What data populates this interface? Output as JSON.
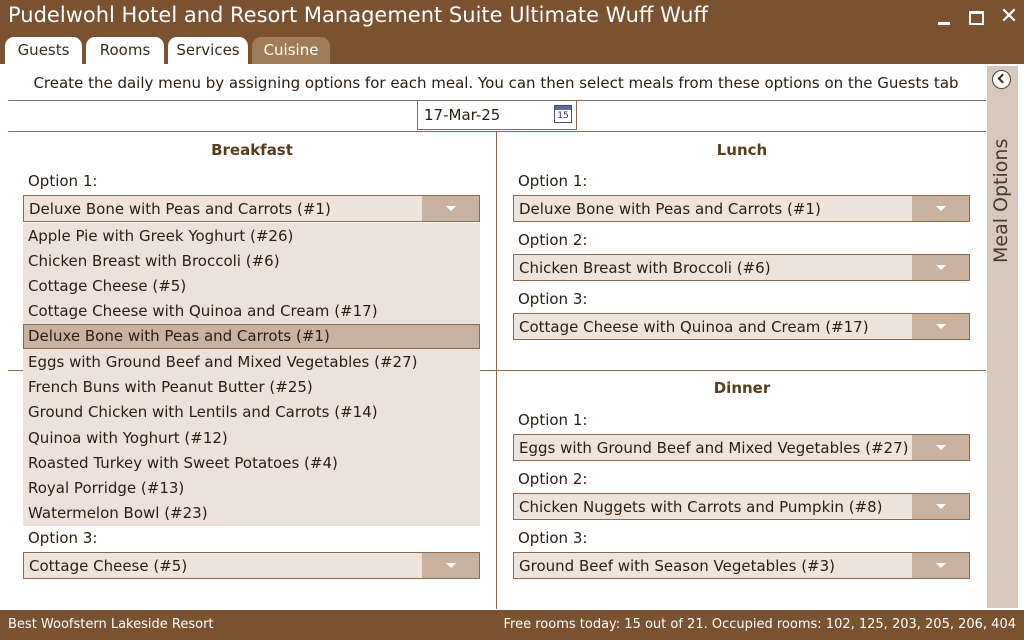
{
  "window": {
    "title": "Pudelwohl Hotel and Resort Management Suite Ultimate Wuff Wuff",
    "minimize_label": "",
    "close_glyph": "✕"
  },
  "tabs": [
    {
      "label": "Guests"
    },
    {
      "label": "Rooms"
    },
    {
      "label": "Services"
    },
    {
      "label": "Cuisine",
      "active": true
    }
  ],
  "cuisine": {
    "instruction": "Create the daily menu by assigning options for each meal. You can then select meals from these options on the Guests tab",
    "date": "17-Mar-25",
    "calendar_day": "15",
    "breakfast": {
      "title": "Breakfast",
      "option1_label": "Option 1:",
      "option1_value": "Deluxe Bone with Peas and Carrots (#1)",
      "option3_label": "Option 3:",
      "option3_value": "Cottage Cheese (#5)",
      "dropdown_items": [
        "Apple Pie with Greek Yoghurt (#26)",
        "Chicken Breast with Broccoli (#6)",
        "Cottage Cheese (#5)",
        "Cottage Cheese with Quinoa and Cream (#17)",
        "Deluxe Bone with Peas and Carrots (#1)",
        "Eggs with Ground Beef and Mixed Vegetables (#27)",
        "French Buns with Peanut Butter (#25)",
        "Ground Chicken with Lentils and Carrots (#14)",
        "Quinoa with Yoghurt (#12)",
        "Roasted Turkey with Sweet Potatoes (#4)",
        "Royal Porridge (#13)",
        "Watermelon Bowl (#23)"
      ],
      "dropdown_selected_index": 4
    },
    "lunch": {
      "title": "Lunch",
      "option1_label": "Option 1:",
      "option1_value": "Deluxe Bone with Peas and Carrots (#1)",
      "option2_label": "Option 2:",
      "option2_value": "Chicken Breast with Broccoli (#6)",
      "option3_label": "Option 3:",
      "option3_value": "Cottage Cheese with Quinoa and Cream (#17)"
    },
    "dinner": {
      "title": "Dinner",
      "option1_label": "Option 1:",
      "option1_value": "Eggs with Ground Beef and Mixed Vegetables (#27)",
      "option2_label": "Option 2:",
      "option2_value": "Chicken Nuggets with Carrots and Pumpkin (#8)",
      "option3_label": "Option 3:",
      "option3_value": "Ground Beef with Season Vegetables (#3)"
    }
  },
  "side_panel": {
    "label": "Meal Options"
  },
  "status": {
    "left": "Best Woofstern Lakeside Resort",
    "right": "Free rooms today: 15 out of 21.  Occupied rooms: 102, 125, 203, 205, 206, 404"
  },
  "colors": {
    "brand": "#7a5230",
    "active_tab": "#a17c58",
    "combo_bg": "#efe4dc",
    "combo_button": "#c9b3a0"
  }
}
